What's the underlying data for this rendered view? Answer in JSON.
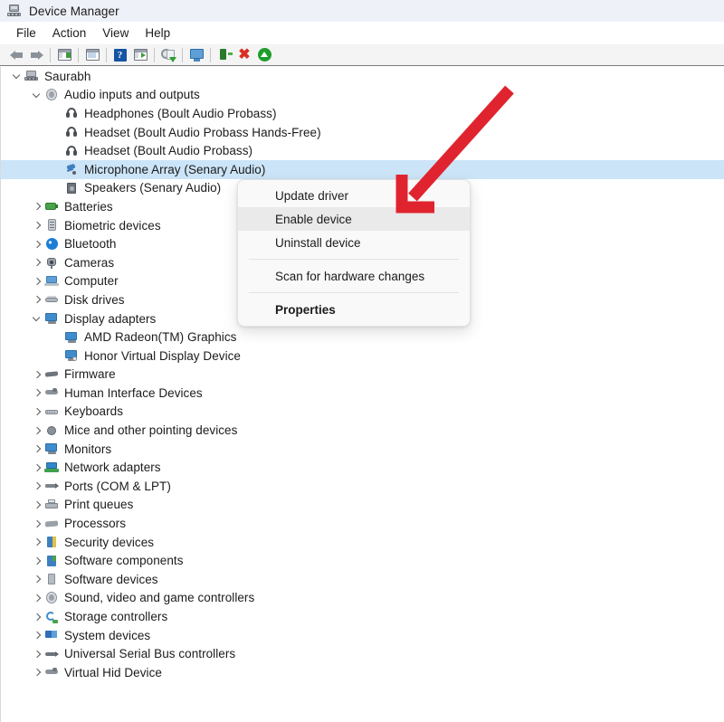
{
  "window": {
    "title": "Device Manager",
    "icon": "device-manager-icon"
  },
  "menubar": {
    "items": [
      {
        "label": "File"
      },
      {
        "label": "Action"
      },
      {
        "label": "View"
      },
      {
        "label": "Help"
      }
    ]
  },
  "toolbar": {
    "buttons": [
      {
        "icon": "back-arrow-icon",
        "tooltip": "Back"
      },
      {
        "icon": "forward-arrow-icon",
        "tooltip": "Forward"
      },
      {
        "icon": "show-hide-console-tree-icon",
        "tooltip": "Show/Hide Console Tree"
      },
      {
        "icon": "properties-icon",
        "tooltip": "Properties"
      },
      {
        "icon": "help-icon",
        "tooltip": "Help"
      },
      {
        "icon": "show-hide-action-pane-icon",
        "tooltip": "Show/Hide Action Pane"
      },
      {
        "icon": "update-driver-icon",
        "tooltip": "Update driver"
      },
      {
        "icon": "scan-hardware-changes-icon",
        "tooltip": "Scan for hardware changes"
      },
      {
        "icon": "uninstall-device-icon",
        "tooltip": "Uninstall device"
      },
      {
        "icon": "disable-device-icon",
        "tooltip": "Disable device"
      },
      {
        "icon": "enable-device-icon",
        "tooltip": "Enable device"
      }
    ]
  },
  "tree": {
    "nodes": [
      {
        "label": "Saurabh",
        "indent": 0,
        "state": "expanded",
        "icon": "computer-icon",
        "selected": false
      },
      {
        "label": "Audio inputs and outputs",
        "indent": 1,
        "state": "expanded",
        "icon": "speaker-round-icon",
        "selected": false
      },
      {
        "label": "Headphones (Boult Audio Probass)",
        "indent": 2,
        "state": "leaf",
        "icon": "headphones-icon",
        "selected": false
      },
      {
        "label": "Headset (Boult Audio Probass Hands-Free)",
        "indent": 2,
        "state": "leaf",
        "icon": "headphones-icon",
        "selected": false
      },
      {
        "label": "Headset (Boult Audio Probass)",
        "indent": 2,
        "state": "leaf",
        "icon": "headphones-icon",
        "selected": false
      },
      {
        "label": "Microphone Array (Senary Audio)",
        "indent": 2,
        "state": "leaf",
        "icon": "microphone-disabled-icon",
        "selected": true
      },
      {
        "label": "Speakers (Senary Audio)",
        "indent": 2,
        "state": "leaf",
        "icon": "speaker-box-icon",
        "selected": false
      },
      {
        "label": "Batteries",
        "indent": 1,
        "state": "collapsed",
        "icon": "battery-icon",
        "selected": false
      },
      {
        "label": "Biometric devices",
        "indent": 1,
        "state": "collapsed",
        "icon": "biometric-icon",
        "selected": false
      },
      {
        "label": "Bluetooth",
        "indent": 1,
        "state": "collapsed",
        "icon": "bluetooth-icon",
        "selected": false
      },
      {
        "label": "Cameras",
        "indent": 1,
        "state": "collapsed",
        "icon": "camera-icon",
        "selected": false
      },
      {
        "label": "Computer",
        "indent": 1,
        "state": "collapsed",
        "icon": "computer-screen-icon",
        "selected": false
      },
      {
        "label": "Disk drives",
        "indent": 1,
        "state": "collapsed",
        "icon": "disk-drive-icon",
        "selected": false
      },
      {
        "label": "Display adapters",
        "indent": 1,
        "state": "expanded",
        "icon": "display-adapter-icon",
        "selected": false
      },
      {
        "label": "AMD Radeon(TM) Graphics",
        "indent": 2,
        "state": "leaf",
        "icon": "display-adapter-icon",
        "selected": false
      },
      {
        "label": "Honor Virtual Display Device",
        "indent": 2,
        "state": "leaf",
        "icon": "virtual-display-icon",
        "selected": false
      },
      {
        "label": "Firmware",
        "indent": 1,
        "state": "collapsed",
        "icon": "firmware-icon",
        "selected": false
      },
      {
        "label": "Human Interface Devices",
        "indent": 1,
        "state": "collapsed",
        "icon": "hid-icon",
        "selected": false
      },
      {
        "label": "Keyboards",
        "indent": 1,
        "state": "collapsed",
        "icon": "keyboard-icon",
        "selected": false
      },
      {
        "label": "Mice and other pointing devices",
        "indent": 1,
        "state": "collapsed",
        "icon": "mouse-icon",
        "selected": false
      },
      {
        "label": "Monitors",
        "indent": 1,
        "state": "collapsed",
        "icon": "monitor-icon",
        "selected": false
      },
      {
        "label": "Network adapters",
        "indent": 1,
        "state": "collapsed",
        "icon": "network-adapter-icon",
        "selected": false
      },
      {
        "label": "Ports (COM & LPT)",
        "indent": 1,
        "state": "collapsed",
        "icon": "port-icon",
        "selected": false
      },
      {
        "label": "Print queues",
        "indent": 1,
        "state": "collapsed",
        "icon": "printer-icon",
        "selected": false
      },
      {
        "label": "Processors",
        "indent": 1,
        "state": "collapsed",
        "icon": "processor-icon",
        "selected": false
      },
      {
        "label": "Security devices",
        "indent": 1,
        "state": "collapsed",
        "icon": "security-device-icon",
        "selected": false
      },
      {
        "label": "Software components",
        "indent": 1,
        "state": "collapsed",
        "icon": "software-component-icon",
        "selected": false
      },
      {
        "label": "Software devices",
        "indent": 1,
        "state": "collapsed",
        "icon": "software-device-icon",
        "selected": false
      },
      {
        "label": "Sound, video and game controllers",
        "indent": 1,
        "state": "collapsed",
        "icon": "speaker-round-icon",
        "selected": false
      },
      {
        "label": "Storage controllers",
        "indent": 1,
        "state": "collapsed",
        "icon": "storage-controller-icon",
        "selected": false
      },
      {
        "label": "System devices",
        "indent": 1,
        "state": "collapsed",
        "icon": "system-device-icon",
        "selected": false
      },
      {
        "label": "Universal Serial Bus controllers",
        "indent": 1,
        "state": "collapsed",
        "icon": "usb-controller-icon",
        "selected": false
      },
      {
        "label": "Virtual Hid Device",
        "indent": 1,
        "state": "collapsed",
        "icon": "hid-icon",
        "selected": false
      }
    ]
  },
  "context_menu": {
    "items": [
      {
        "label": "Update driver",
        "type": "item",
        "highlighted": false,
        "bold": false
      },
      {
        "label": "Enable device",
        "type": "item",
        "highlighted": true,
        "bold": false
      },
      {
        "label": "Uninstall device",
        "type": "item",
        "highlighted": false,
        "bold": false
      },
      {
        "label": "",
        "type": "separator"
      },
      {
        "label": "Scan for hardware changes",
        "type": "item",
        "highlighted": false,
        "bold": false
      },
      {
        "label": "",
        "type": "separator"
      },
      {
        "label": "Properties",
        "type": "item",
        "highlighted": false,
        "bold": true
      }
    ]
  },
  "annotation": {
    "arrow": {
      "name": "red-pointer-arrow",
      "color": "#e0242f",
      "points_to": "Enable device"
    }
  },
  "colors": {
    "titlebar_bg": "#eef1f8",
    "toolbar_bg": "#f4f4f4",
    "selection_bg": "#cce4f7",
    "menu_bg": "#f9f9f9",
    "menu_highlight": "#eaeaea",
    "accent_red": "#e0242f",
    "text": "#1b1b1b"
  }
}
